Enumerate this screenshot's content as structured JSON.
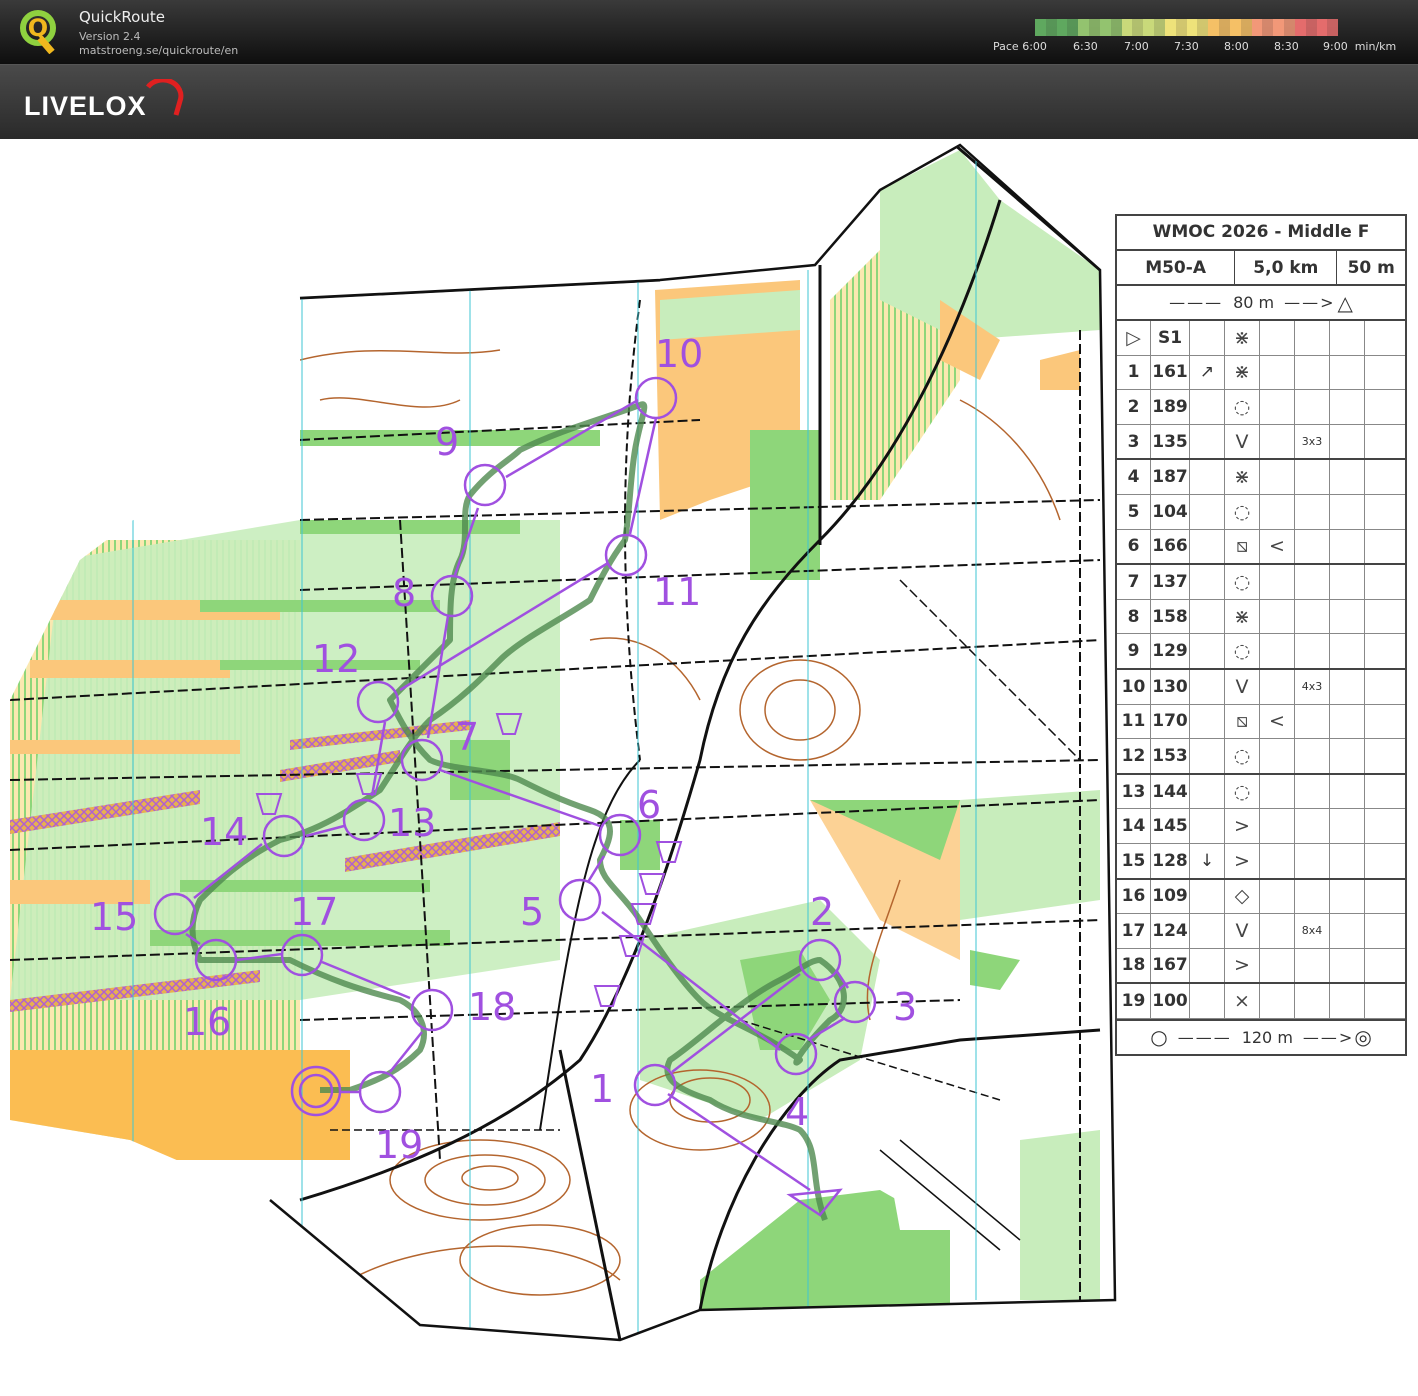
{
  "app": {
    "name": "QuickRoute",
    "version": "Version 2.4",
    "url": "matstroeng.se/quickroute/en",
    "logo_letter": "Q"
  },
  "pace": {
    "prefix": "Pace",
    "unit": "min/km",
    "ticks": [
      "6:00",
      "6:30",
      "7:00",
      "7:30",
      "8:00",
      "8:30",
      "9:00"
    ],
    "scale_colors": [
      "#5fa85f",
      "#93c36f",
      "#c9d97a",
      "#eee27a",
      "#f5c066",
      "#f29878",
      "#e46c6c"
    ]
  },
  "brand": {
    "name": "LIVELOX",
    "accent": "#e02020"
  },
  "course": {
    "title": "WMOC 2026 - Middle F",
    "class": "M50-A",
    "length": "5,0 km",
    "climb": "50 m",
    "start_marking": "80 m",
    "finish_marking": "120 m",
    "start": {
      "code": "S1",
      "d": "crossing",
      "g": "",
      "h": ""
    },
    "controls": [
      {
        "n": "1",
        "code": "161",
        "c": "↗",
        "d": "crossing",
        "e": "",
        "f": "",
        "g": "",
        "h": ""
      },
      {
        "n": "2",
        "code": "189",
        "c": "",
        "d": "dotted",
        "e": "",
        "f": "",
        "g": "",
        "h": ""
      },
      {
        "n": "3",
        "code": "135",
        "c": "",
        "d": "V",
        "e": "",
        "f": "3x3",
        "g": "",
        "h": ""
      },
      {
        "n": "4",
        "code": "187",
        "c": "",
        "d": "crossing",
        "e": "",
        "f": "",
        "g": "",
        "h": ""
      },
      {
        "n": "5",
        "code": "104",
        "c": "",
        "d": "dotted",
        "e": "",
        "f": "",
        "g": "",
        "h": ""
      },
      {
        "n": "6",
        "code": "166",
        "c": "",
        "d": "hatch",
        "e": "<",
        "f": "",
        "g": "",
        "h": ""
      },
      {
        "n": "7",
        "code": "137",
        "c": "",
        "d": "dotted",
        "e": "",
        "f": "",
        "g": "",
        "h": ""
      },
      {
        "n": "8",
        "code": "158",
        "c": "",
        "d": "crossing",
        "e": "",
        "f": "",
        "g": "",
        "h": ""
      },
      {
        "n": "9",
        "code": "129",
        "c": "",
        "d": "dotted",
        "e": "",
        "f": "",
        "g": "",
        "h": ""
      },
      {
        "n": "10",
        "code": "130",
        "c": "",
        "d": "V",
        "e": "",
        "f": "4x3",
        "g": "",
        "h": ""
      },
      {
        "n": "11",
        "code": "170",
        "c": "",
        "d": "hatch",
        "e": "<",
        "f": "",
        "g": "",
        "h": ""
      },
      {
        "n": "12",
        "code": "153",
        "c": "",
        "d": "dotted",
        "e": "",
        "f": "",
        "g": "",
        "h": ""
      },
      {
        "n": "13",
        "code": "144",
        "c": "",
        "d": "dotted",
        "e": "",
        "f": "",
        "g": "",
        "h": ""
      },
      {
        "n": "14",
        "code": "145",
        "c": "",
        "d": ">",
        "e": "",
        "f": "",
        "g": "",
        "h": ""
      },
      {
        "n": "15",
        "code": "128",
        "c": "↓",
        "d": ">",
        "e": "",
        "f": "",
        "g": "",
        "h": ""
      },
      {
        "n": "16",
        "code": "109",
        "c": "",
        "d": "◇",
        "e": "",
        "f": "",
        "g": "",
        "h": ""
      },
      {
        "n": "17",
        "code": "124",
        "c": "",
        "d": "V",
        "e": "",
        "f": "8x4",
        "g": "",
        "h": ""
      },
      {
        "n": "18",
        "code": "167",
        "c": "",
        "d": ">",
        "e": "",
        "f": "",
        "g": "",
        "h": ""
      },
      {
        "n": "19",
        "code": "100",
        "c": "",
        "d": "×",
        "e": "",
        "f": "",
        "g": "",
        "h": ""
      }
    ]
  },
  "map_labels": [
    "1",
    "2",
    "3",
    "4",
    "5",
    "6",
    "7",
    "8",
    "9",
    "10",
    "11",
    "12",
    "13",
    "14",
    "15",
    "16",
    "17",
    "18",
    "19"
  ],
  "colors": {
    "course": "#a050e0",
    "route": "#4f8a4f",
    "green": "#8ed67a",
    "lightgreen": "#c8edbc",
    "yellow": "#fbc77b",
    "contour": "#b4652e",
    "path": "#111111",
    "magnetic": "#3fc6d3"
  }
}
